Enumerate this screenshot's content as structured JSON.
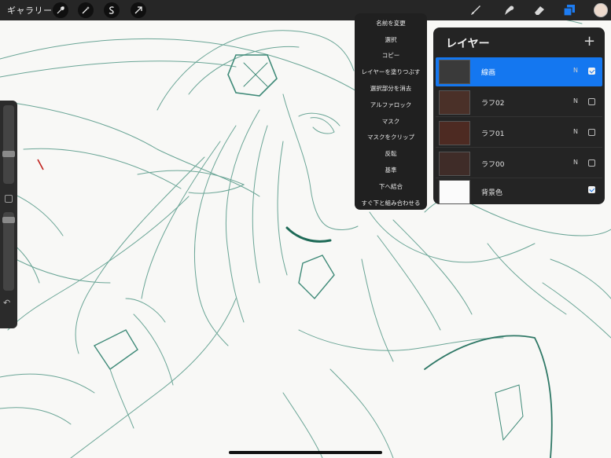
{
  "topbar": {
    "gallery_label": "ギャラリー",
    "action_icons": [
      "wrench-icon",
      "magic-wand-icon",
      "selection-icon",
      "transform-arrow-icon"
    ],
    "tools": [
      "brush-icon",
      "smudge-icon",
      "eraser-icon",
      "layers-icon"
    ],
    "active_tool": "layers-icon",
    "current_color": "#ecd9cc"
  },
  "context_menu": {
    "items": [
      "名前を変更",
      "選択",
      "コピー",
      "レイヤーを塗りつぶす",
      "選択部分を消去",
      "アルファロック",
      "マスク",
      "マスクをクリップ",
      "反転",
      "基準",
      "下へ結合",
      "すぐ下と組み合わせる"
    ]
  },
  "layers_panel": {
    "title": "レイヤー",
    "add_icon": "plus-icon",
    "layers": [
      {
        "name": "線画",
        "mode": "N",
        "visible": true,
        "active": true
      },
      {
        "name": "ラフ02",
        "mode": "N",
        "visible": false,
        "active": false
      },
      {
        "name": "ラフ01",
        "mode": "N",
        "visible": false,
        "active": false
      },
      {
        "name": "ラフ00",
        "mode": "N",
        "visible": false,
        "active": false
      },
      {
        "name": "背景色",
        "mode": "",
        "visible": true,
        "active": false
      }
    ]
  },
  "colors": {
    "accent": "#1477f0",
    "lineart": "#3f8a78",
    "toolbar": "#262626"
  }
}
